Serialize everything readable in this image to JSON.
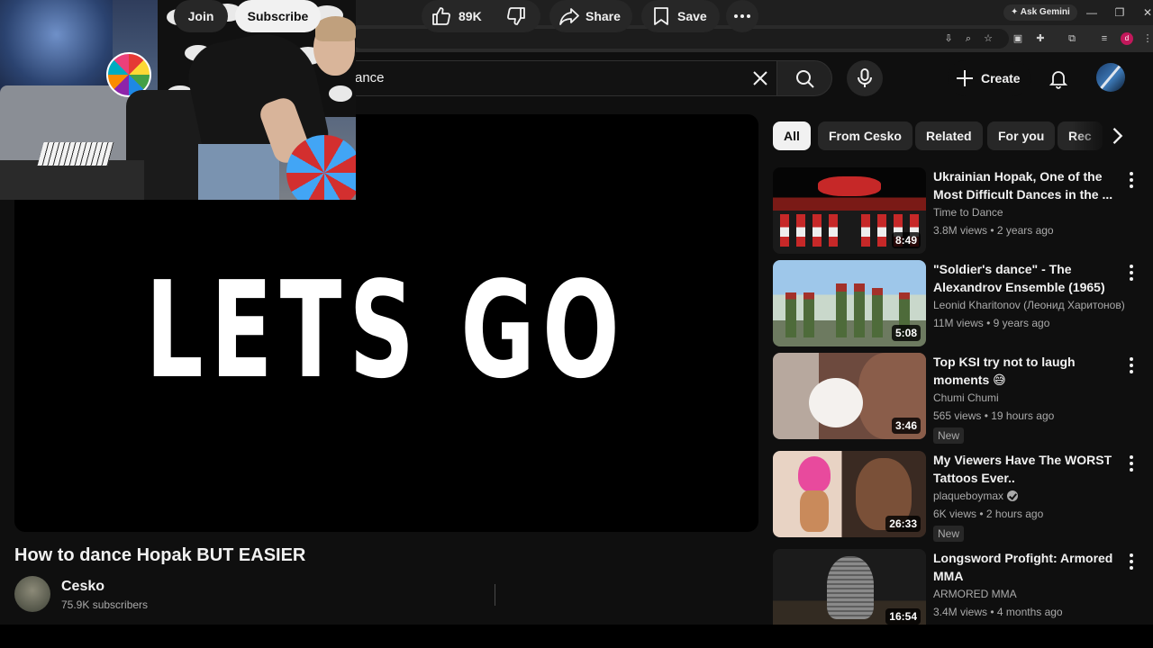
{
  "browser": {
    "gemini_label": "Ask Gemini",
    "profile_initial": "d"
  },
  "search": {
    "query": "ance"
  },
  "header": {
    "create_label": "Create"
  },
  "player": {
    "overlay_text": "LETS GO"
  },
  "video": {
    "title": "How to dance Hopak BUT EASIER",
    "channel": "Cesko",
    "subscribers": "75.9K subscribers",
    "join_label": "Join",
    "subscribe_label": "Subscribe",
    "likes": "89K",
    "share_label": "Share",
    "save_label": "Save"
  },
  "chips": [
    "All",
    "From Cesko",
    "Related",
    "For you",
    "Rec"
  ],
  "recommendations": [
    {
      "title": "Ukrainian Hopak, One of the Most Difficult Dances in the ...",
      "channel": "Time to Dance",
      "meta": "3.8M views • 2 years ago",
      "duration": "8:49",
      "badge": ""
    },
    {
      "title": "\"Soldier's dance\" - The Alexandrov Ensemble (1965)",
      "channel": "Leonid Kharitonov (Леонид Харитонов)",
      "meta": "11M views • 9 years ago",
      "duration": "5:08",
      "badge": ""
    },
    {
      "title": "Top  KSI try not to laugh moments 😅",
      "channel": "Chumi Chumi",
      "meta": "565 views • 19 hours ago",
      "duration": "3:46",
      "badge": "New"
    },
    {
      "title": "My Viewers Have The WORST Tattoos Ever..",
      "channel": "plaqueboymax",
      "meta": "6K views • 2 hours ago",
      "duration": "26:33",
      "badge": "New"
    },
    {
      "title": "Longsword Profight: Armored MMA",
      "channel": "ARMORED MMA",
      "meta": "3.4M views • 4 months ago",
      "duration": "16:54",
      "badge": ""
    }
  ],
  "colors": {
    "background": "#0f0f0f",
    "chip_active": "#f1f1f1",
    "secondary_text": "#aaaaaa"
  }
}
